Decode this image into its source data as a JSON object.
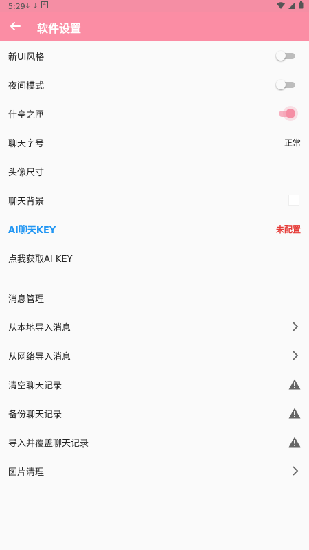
{
  "status_bar": {
    "time": "5:29"
  },
  "app_bar": {
    "title": "软件设置"
  },
  "settings": {
    "new_ui": {
      "label": "新UI风格",
      "enabled": false
    },
    "night_mode": {
      "label": "夜间模式",
      "enabled": false
    },
    "item3": {
      "label": "什亭之匣",
      "enabled": true
    },
    "font_size": {
      "label": "聊天字号",
      "value": "正常"
    },
    "avatar_size": {
      "label": "头像尺寸"
    },
    "chat_bg": {
      "label": "聊天背景"
    },
    "ai_key": {
      "label": "AI聊天KEY",
      "value": "未配置"
    },
    "get_ai_key": {
      "label": "点我获取AI KEY"
    }
  },
  "message_management": {
    "header": "消息管理",
    "items": [
      {
        "label": "从本地导入消息",
        "icon": "chevron-right-icon"
      },
      {
        "label": "从网络导入消息",
        "icon": "chevron-right-icon"
      },
      {
        "label": "清空聊天记录",
        "icon": "warning-icon"
      },
      {
        "label": "备份聊天记录",
        "icon": "warning-icon"
      },
      {
        "label": "导入并覆盖聊天记录",
        "icon": "warning-icon"
      },
      {
        "label": "图片清理",
        "icon": "chevron-right-icon"
      }
    ]
  },
  "colors": {
    "accent": "#fb8da4",
    "link_blue": "#2196f3",
    "error_red": "#e53935"
  }
}
